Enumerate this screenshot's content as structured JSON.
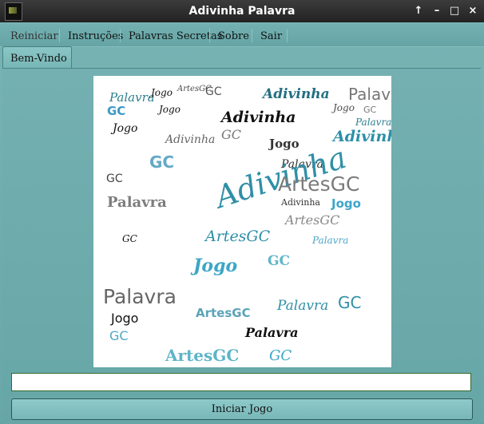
{
  "window": {
    "title": "Adivinha Palavra",
    "controls": [
      "↑",
      "–",
      "□",
      "×"
    ]
  },
  "menu": [
    "Reiniciar",
    "Instruções",
    "Palavras Secretas",
    "Sobre",
    "Sair"
  ],
  "tab": {
    "label": "Bem-Vindo"
  },
  "word_cloud": {
    "words": [
      "Palavra",
      "Jogo",
      "ArtesGC",
      "GC",
      "Adivinha",
      "Palavra",
      "GC",
      "Jogo",
      "Adivinha",
      "Jogo",
      "GC",
      "Palavra",
      "Jogo",
      "Adivinha",
      "GC",
      "Jogo",
      "Adivinha",
      "GC",
      "Palavra",
      "Adivinha",
      "ArtesGC",
      "GC",
      "Palavra",
      "Adivinha",
      "ArtesGC",
      "Jogo",
      "GC",
      "ArtesGC",
      "Palavra",
      "Jogo",
      "GC",
      "Palavra",
      "ArtesGC",
      "Palavra",
      "GC",
      "Jogo",
      "GC",
      "Palavra",
      "ArtesGC",
      "GC"
    ],
    "colors": [
      "#2b7f8f",
      "#56aebf",
      "#7c7c7c",
      "#0d2430",
      "#4ea7c6"
    ]
  },
  "input": {
    "value": ""
  },
  "start_button": {
    "label": "Iniciar Jogo"
  }
}
